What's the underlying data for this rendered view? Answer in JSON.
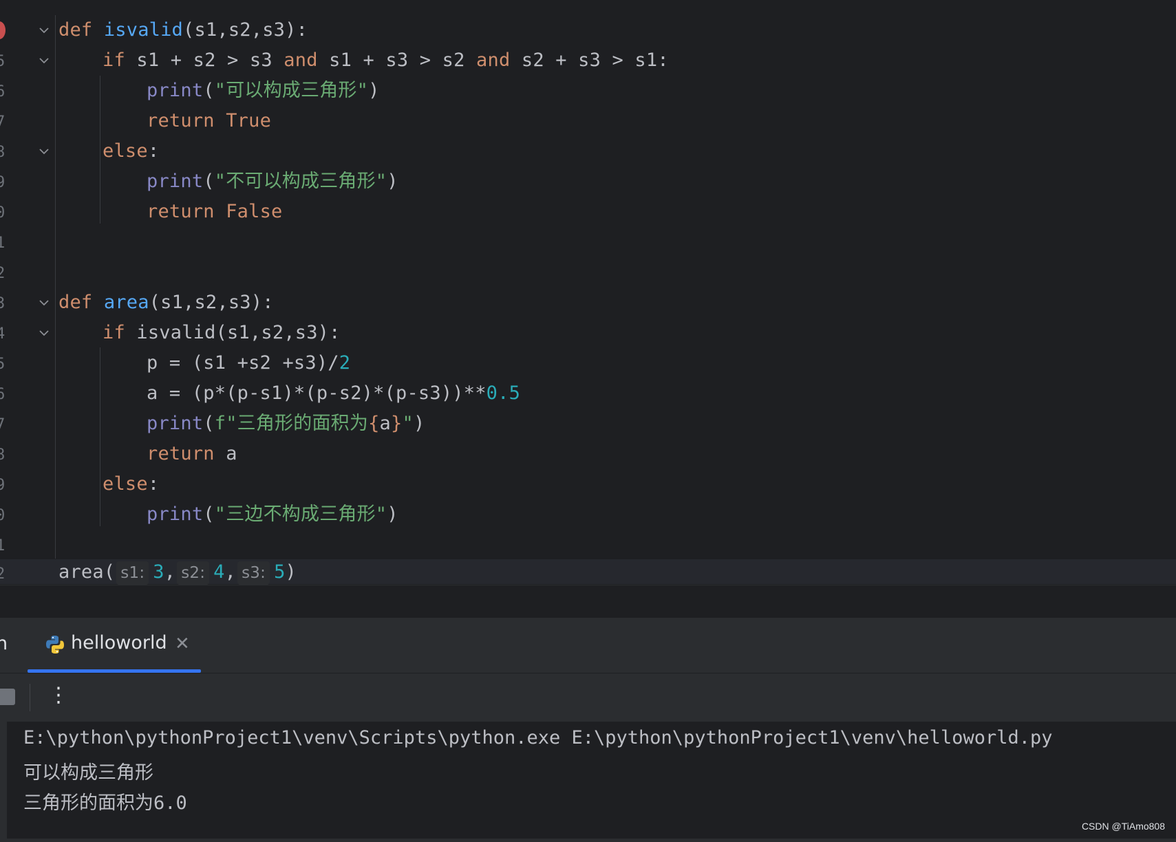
{
  "gutter": {
    "line_numbers": [
      "",
      "5",
      "6",
      "7",
      "8",
      "9",
      "0",
      "1",
      "2",
      "3",
      "4",
      "5",
      "6",
      "7",
      "8",
      "9",
      "0",
      "1",
      "2"
    ]
  },
  "code": {
    "l1": {
      "kw": "def ",
      "fn": "isvalid",
      "rest": "(s1,s2,s3):"
    },
    "l2": {
      "kw1": "if ",
      "a": "s1 + s2 > s3 ",
      "kw2": "and ",
      "b": "s1 + s3 > s2 ",
      "kw3": "and ",
      "c": "s2 + s3 > s1:"
    },
    "l3": {
      "bi": "print",
      "p1": "(",
      "str": "\"可以构成三角形\"",
      "p2": ")"
    },
    "l4": {
      "kw": "return ",
      "val": "True"
    },
    "l5": {
      "kw": "else",
      "rest": ":"
    },
    "l6": {
      "bi": "print",
      "p1": "(",
      "str": "\"不可以构成三角形\"",
      "p2": ")"
    },
    "l7": {
      "kw": "return ",
      "val": "False"
    },
    "l10": {
      "kw": "def ",
      "fn": "area",
      "rest": "(s1,s2,s3):"
    },
    "l11": {
      "kw": "if ",
      "rest": "isvalid(s1,s2,s3):"
    },
    "l12": {
      "a": "p = (s1 +s2 +s3)/",
      "num": "2"
    },
    "l13": {
      "a": "a = (p*(p-s1)*(p-s2)*(p-s3))**",
      "num": "0.5"
    },
    "l14": {
      "bi": "print",
      "p1": "(",
      "s1": "f\"三角形的面积为",
      "b1": "{",
      "var": "a",
      "b2": "}",
      "s2": "\"",
      "p2": ")"
    },
    "l15": {
      "kw": "return ",
      "rest": "a"
    },
    "l16": {
      "kw": "else",
      "rest": ":"
    },
    "l17": {
      "bi": "print",
      "p1": "(",
      "str": "\"三边不构成三角形\"",
      "p2": ")"
    },
    "l19": {
      "fn": "area",
      "p1": "(",
      "hint1": "s1:",
      "v1": "3",
      "c1": ",",
      "hint2": "s2:",
      "v2": "4",
      "c2": ",",
      "hint3": "s3:",
      "v3": "5",
      "p2": ")"
    }
  },
  "run_panel": {
    "label": "n",
    "tab_label": "helloworld",
    "tab_close": "✕",
    "more_icon": "⋮"
  },
  "console": {
    "lines": [
      "E:\\python\\pythonProject1\\venv\\Scripts\\python.exe E:\\python\\pythonProject1\\venv\\helloworld.py",
      "可以构成三角形",
      "三角形的面积为6.0"
    ]
  },
  "watermark": "CSDN @TiAmo808",
  "colors": {
    "background": "#1e1f22",
    "keyword": "#cf8e6d",
    "function": "#56a8f5",
    "builtin": "#8888c6",
    "string": "#6aab73",
    "number": "#2aacb8",
    "tab_accent": "#3574f0"
  }
}
